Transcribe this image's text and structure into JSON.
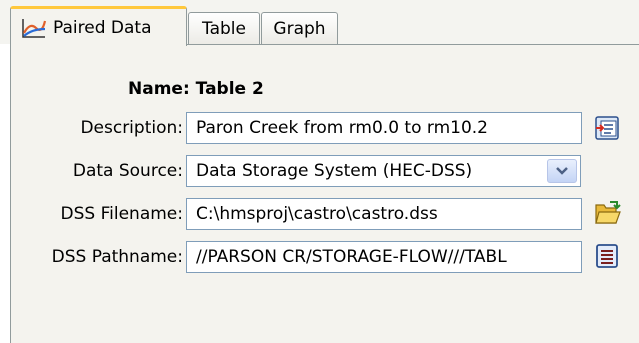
{
  "tabs": [
    {
      "label": "Paired Data",
      "icon": "paired-data-chart-icon",
      "active": true
    },
    {
      "label": "Table",
      "active": false
    },
    {
      "label": "Graph",
      "active": false
    }
  ],
  "form": {
    "name_label": "Name:",
    "name_value": "Table 2",
    "description_label": "Description:",
    "description_value": "Paron Creek from rm0.0 to rm10.2",
    "data_source_label": "Data Source:",
    "data_source_value": "Data Storage System (HEC-DSS)",
    "dss_filename_label": "DSS Filename:",
    "dss_filename_value": "C:\\hmsproj\\castro\\castro.dss",
    "dss_pathname_label": "DSS Pathname:",
    "dss_pathname_value": "//PARSON CR/STORAGE-FLOW///TABL"
  },
  "icons": {
    "description_editor": "description-editor-icon",
    "data_source_dropdown": "chevron-down-icon",
    "filename_browse": "open-folder-icon",
    "pathname_selector": "record-list-icon"
  },
  "colors": {
    "active_tab_accent": "#ffc83c",
    "panel_background": "#f4f3ee",
    "field_border": "#7f9db9"
  }
}
